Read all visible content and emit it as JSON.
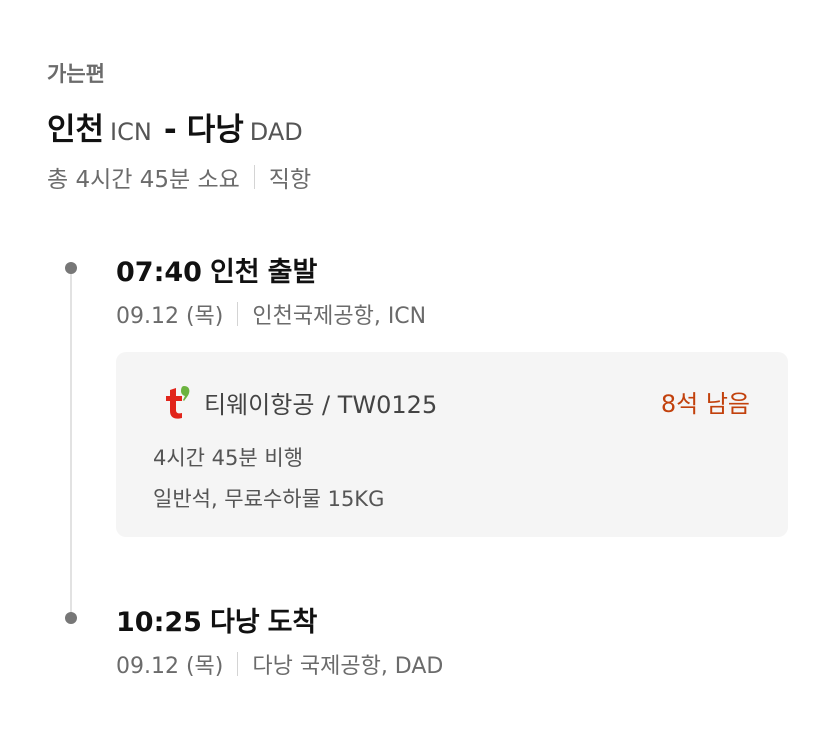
{
  "section_label": "가는편",
  "route": {
    "origin_city": "인천",
    "origin_code": "ICN",
    "separator": "-",
    "dest_city": "다낭",
    "dest_code": "DAD"
  },
  "summary": {
    "duration": "총 4시간 45분 소요",
    "flight_type": "직항"
  },
  "departure": {
    "time": "07:40",
    "city": "인천",
    "action": "출발",
    "date": "09.12 (목)",
    "airport": "인천국제공항, ICN"
  },
  "flight": {
    "airline": "티웨이항공 / TW0125",
    "logo_icon": "tway-logo-icon",
    "seats_left": "8석 남음",
    "flight_time": "4시간 45분 비행",
    "cabin_baggage": "일반석, 무료수하물 15KG"
  },
  "arrival": {
    "time": "10:25",
    "city": "다낭",
    "action": "도착",
    "date": "09.12 (목)",
    "airport": "다낭 국제공항, DAD"
  },
  "colors": {
    "accent_seats": "#c2410c",
    "logo_red": "#e1251b",
    "logo_green": "#6cb33f",
    "card_bg": "#f5f5f5"
  }
}
